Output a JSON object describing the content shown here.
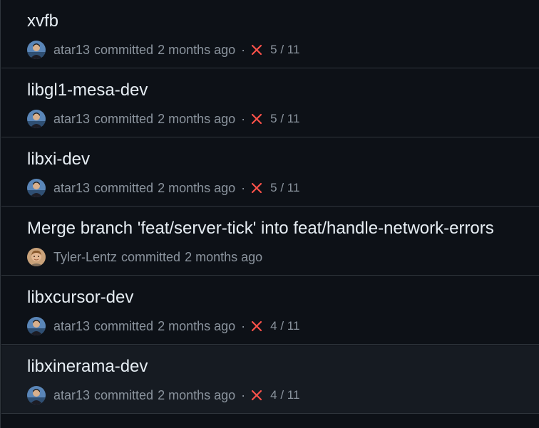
{
  "colors": {
    "background": "#0d1117",
    "row_hover": "#161b22",
    "border": "#30363d",
    "title_text": "#e6edf3",
    "muted_text": "#8b949e",
    "failure": "#f85149"
  },
  "commits": [
    {
      "title": "xvfb",
      "author": "atar13",
      "verb": "committed",
      "time": "2 months ago",
      "separator": "·",
      "status_icon": "x-icon",
      "checks": "5 / 11"
    },
    {
      "title": "libgl1-mesa-dev",
      "author": "atar13",
      "verb": "committed",
      "time": "2 months ago",
      "separator": "·",
      "status_icon": "x-icon",
      "checks": "5 / 11"
    },
    {
      "title": "libxi-dev",
      "author": "atar13",
      "verb": "committed",
      "time": "2 months ago",
      "separator": "·",
      "status_icon": "x-icon",
      "checks": "5 / 11"
    },
    {
      "title": "Merge branch 'feat/server-tick' into feat/handle-network-errors",
      "author": "Tyler-Lentz",
      "verb": "committed",
      "time": "2 months ago"
    },
    {
      "title": "libxcursor-dev",
      "author": "atar13",
      "verb": "committed",
      "time": "2 months ago",
      "separator": "·",
      "status_icon": "x-icon",
      "checks": "4 / 11"
    },
    {
      "title": "libxinerama-dev",
      "author": "atar13",
      "verb": "committed",
      "time": "2 months ago",
      "separator": "·",
      "status_icon": "x-icon",
      "checks": "4 / 11"
    }
  ]
}
